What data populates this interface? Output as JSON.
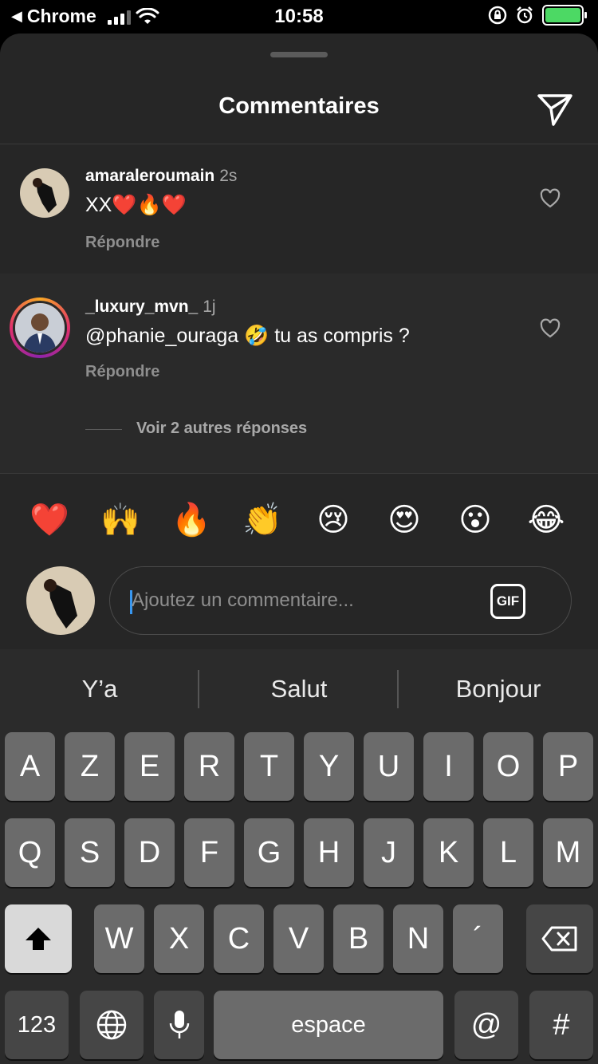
{
  "status_bar": {
    "back_app": "Chrome",
    "time": "10:58"
  },
  "sheet": {
    "title": "Commentaires"
  },
  "comments": [
    {
      "username": "amaraleroumain",
      "time": "2s",
      "text": "XX❤️🔥❤️",
      "reply_label": "Répondre"
    },
    {
      "username": "_luxury_mvn_",
      "time": "1j",
      "text": "@phanie_ouraga 🤣 tu as compris ?",
      "reply_label": "Répondre",
      "more_replies": "Voir 2 autres réponses"
    }
  ],
  "quick_reactions": [
    "❤️",
    "🙌",
    "🔥",
    "👏",
    "😢",
    "😍",
    "😮",
    "😂"
  ],
  "comment_input": {
    "placeholder": "Ajoutez un commentaire...",
    "gif_label": "GIF"
  },
  "keyboard": {
    "suggestions": [
      "Y’a",
      "Salut",
      "Bonjour"
    ],
    "row1": [
      "A",
      "Z",
      "E",
      "R",
      "T",
      "Y",
      "U",
      "I",
      "O",
      "P"
    ],
    "row2": [
      "Q",
      "S",
      "D",
      "F",
      "G",
      "H",
      "J",
      "K",
      "L",
      "M"
    ],
    "row3": [
      "W",
      "X",
      "C",
      "V",
      "B",
      "N",
      "´"
    ],
    "numbers_key": "123",
    "space_key": "espace",
    "at_key": "@",
    "hash_key": "#"
  },
  "colors": {
    "sheet_bg": "#262626",
    "accent_caret": "#3897f0",
    "battery": "#4cd964"
  }
}
